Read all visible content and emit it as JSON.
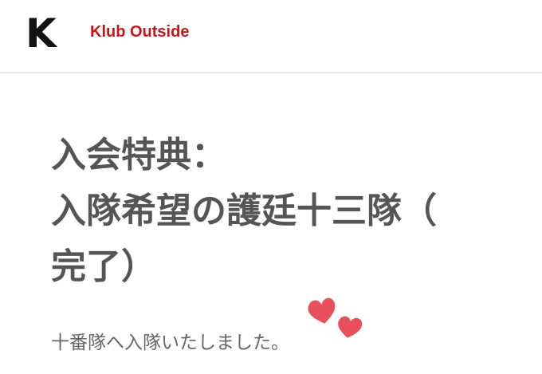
{
  "header": {
    "logo_letter": "K",
    "site_name": "Klub Outside"
  },
  "article": {
    "title_lines": [
      "入会特典：",
      "入隊希望の護廷十三隊（",
      "完了）"
    ],
    "body": "十番隊へ入隊いたしました。"
  },
  "icons": {
    "hearts": "two-hearts-icon",
    "heart_color": "#e8505b"
  }
}
